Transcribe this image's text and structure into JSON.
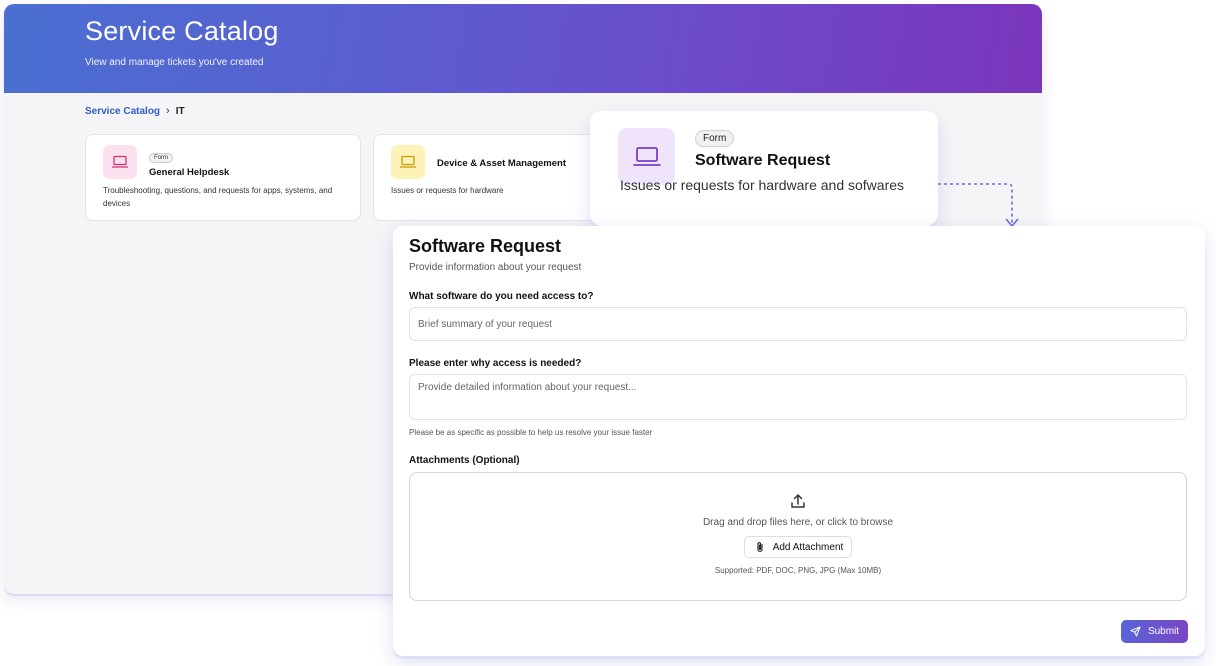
{
  "catalog": {
    "title": "Service Catalog",
    "subtitle": "View and manage tickets you've created",
    "breadcrumb": {
      "root": "Service Catalog",
      "separator": "›",
      "current": "IT"
    },
    "cards": [
      {
        "tag": "Form",
        "title": "General Helpdesk",
        "description": "Troubleshooting, questions, and requests for apps, systems, and devices",
        "icon": "laptop-icon",
        "icon_color": "#d6336c",
        "bg": "#fbe0ef"
      },
      {
        "title": "Device & Asset Management",
        "description": "Issues or requests for hardware",
        "icon": "laptop-icon",
        "icon_color": "#c99a06",
        "bg": "#fdf3b8"
      }
    ]
  },
  "featured": {
    "tag": "Form",
    "title": "Software Request",
    "description": "Issues or requests for hardware and sofwares",
    "icon": "laptop-icon",
    "icon_color": "#7b3fc9"
  },
  "form": {
    "title": "Software Request",
    "subtitle": "Provide information about your request",
    "fields": [
      {
        "label": "What software do you need access to?",
        "placeholder": "Brief summary of your request"
      },
      {
        "label": "Please enter why access is needed?",
        "placeholder": "Provide detailed information about your request...",
        "hint": "Please be as specific as possible to help us resolve your issue faster"
      }
    ],
    "attachments": {
      "label": "Attachments (Optional)",
      "drop_text": "Drag and drop files here, or click to browse",
      "button": "Add Attachment",
      "supported": "Supported: PDF, DOC, PNG, JPG (Max 10MB)"
    },
    "submit": "Submit"
  },
  "colors": {
    "accent_start": "#5865d8",
    "accent_end": "#7b45c4",
    "link": "#2b5cc8"
  }
}
